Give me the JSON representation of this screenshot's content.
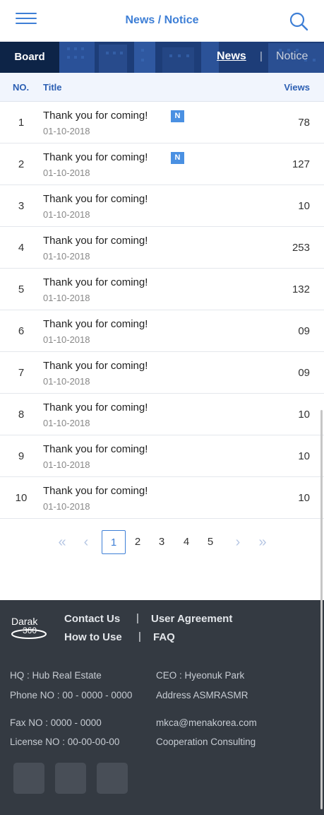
{
  "header": {
    "title": "News / Notice"
  },
  "banner": {
    "board_label": "Board",
    "tab_news": "News",
    "separator": "|",
    "tab_notice": "Notice"
  },
  "table": {
    "col_no": "NO.",
    "col_title": "Title",
    "col_views": "Views",
    "new_badge": "N",
    "rows": [
      {
        "no": "1",
        "title": "Thank you for coming!",
        "date": "01-10-2018",
        "views": "78",
        "is_new": true
      },
      {
        "no": "2",
        "title": "Thank you for coming!",
        "date": "01-10-2018",
        "views": "127",
        "is_new": true
      },
      {
        "no": "3",
        "title": "Thank you for coming!",
        "date": "01-10-2018",
        "views": "10",
        "is_new": false
      },
      {
        "no": "4",
        "title": "Thank you for coming!",
        "date": "01-10-2018",
        "views": "253",
        "is_new": false
      },
      {
        "no": "5",
        "title": "Thank you for coming!",
        "date": "01-10-2018",
        "views": "132",
        "is_new": false
      },
      {
        "no": "6",
        "title": "Thank you for coming!",
        "date": "01-10-2018",
        "views": "09",
        "is_new": false
      },
      {
        "no": "7",
        "title": "Thank you for coming!",
        "date": "01-10-2018",
        "views": "09",
        "is_new": false
      },
      {
        "no": "8",
        "title": "Thank you for coming!",
        "date": "01-10-2018",
        "views": "10",
        "is_new": false
      },
      {
        "no": "9",
        "title": "Thank you for coming!",
        "date": "01-10-2018",
        "views": "10",
        "is_new": false
      },
      {
        "no": "10",
        "title": "Thank you for coming!",
        "date": "01-10-2018",
        "views": "10",
        "is_new": false
      }
    ]
  },
  "pagination": {
    "first": "«",
    "prev": "‹",
    "pages": [
      "1",
      "2",
      "3",
      "4",
      "5"
    ],
    "current": "1",
    "next": "›",
    "last": "»"
  },
  "footer": {
    "logo_text": "Darak 360",
    "links": {
      "contact": "Contact Us",
      "agreement": "User Agreement",
      "how_to_use": "How to Use",
      "faq": "FAQ",
      "sep": "|"
    },
    "hq": "HQ : Hub Real Estate",
    "ceo": "CEO : Hyeonuk Park",
    "phone": "Phone NO : 00 - 0000 - 0000",
    "address": "Address ASMRASMR",
    "fax": "Fax NO : 0000 - 0000",
    "email": "mkca@menakorea.com",
    "license": "License NO : 00-00-00-00",
    "cooperation": "Cooperation Consulting"
  },
  "colors": {
    "accent": "#3e7fd6",
    "banner": "#1f3f7a",
    "footer_bg": "#343a42",
    "badge": "#4a90e2"
  }
}
